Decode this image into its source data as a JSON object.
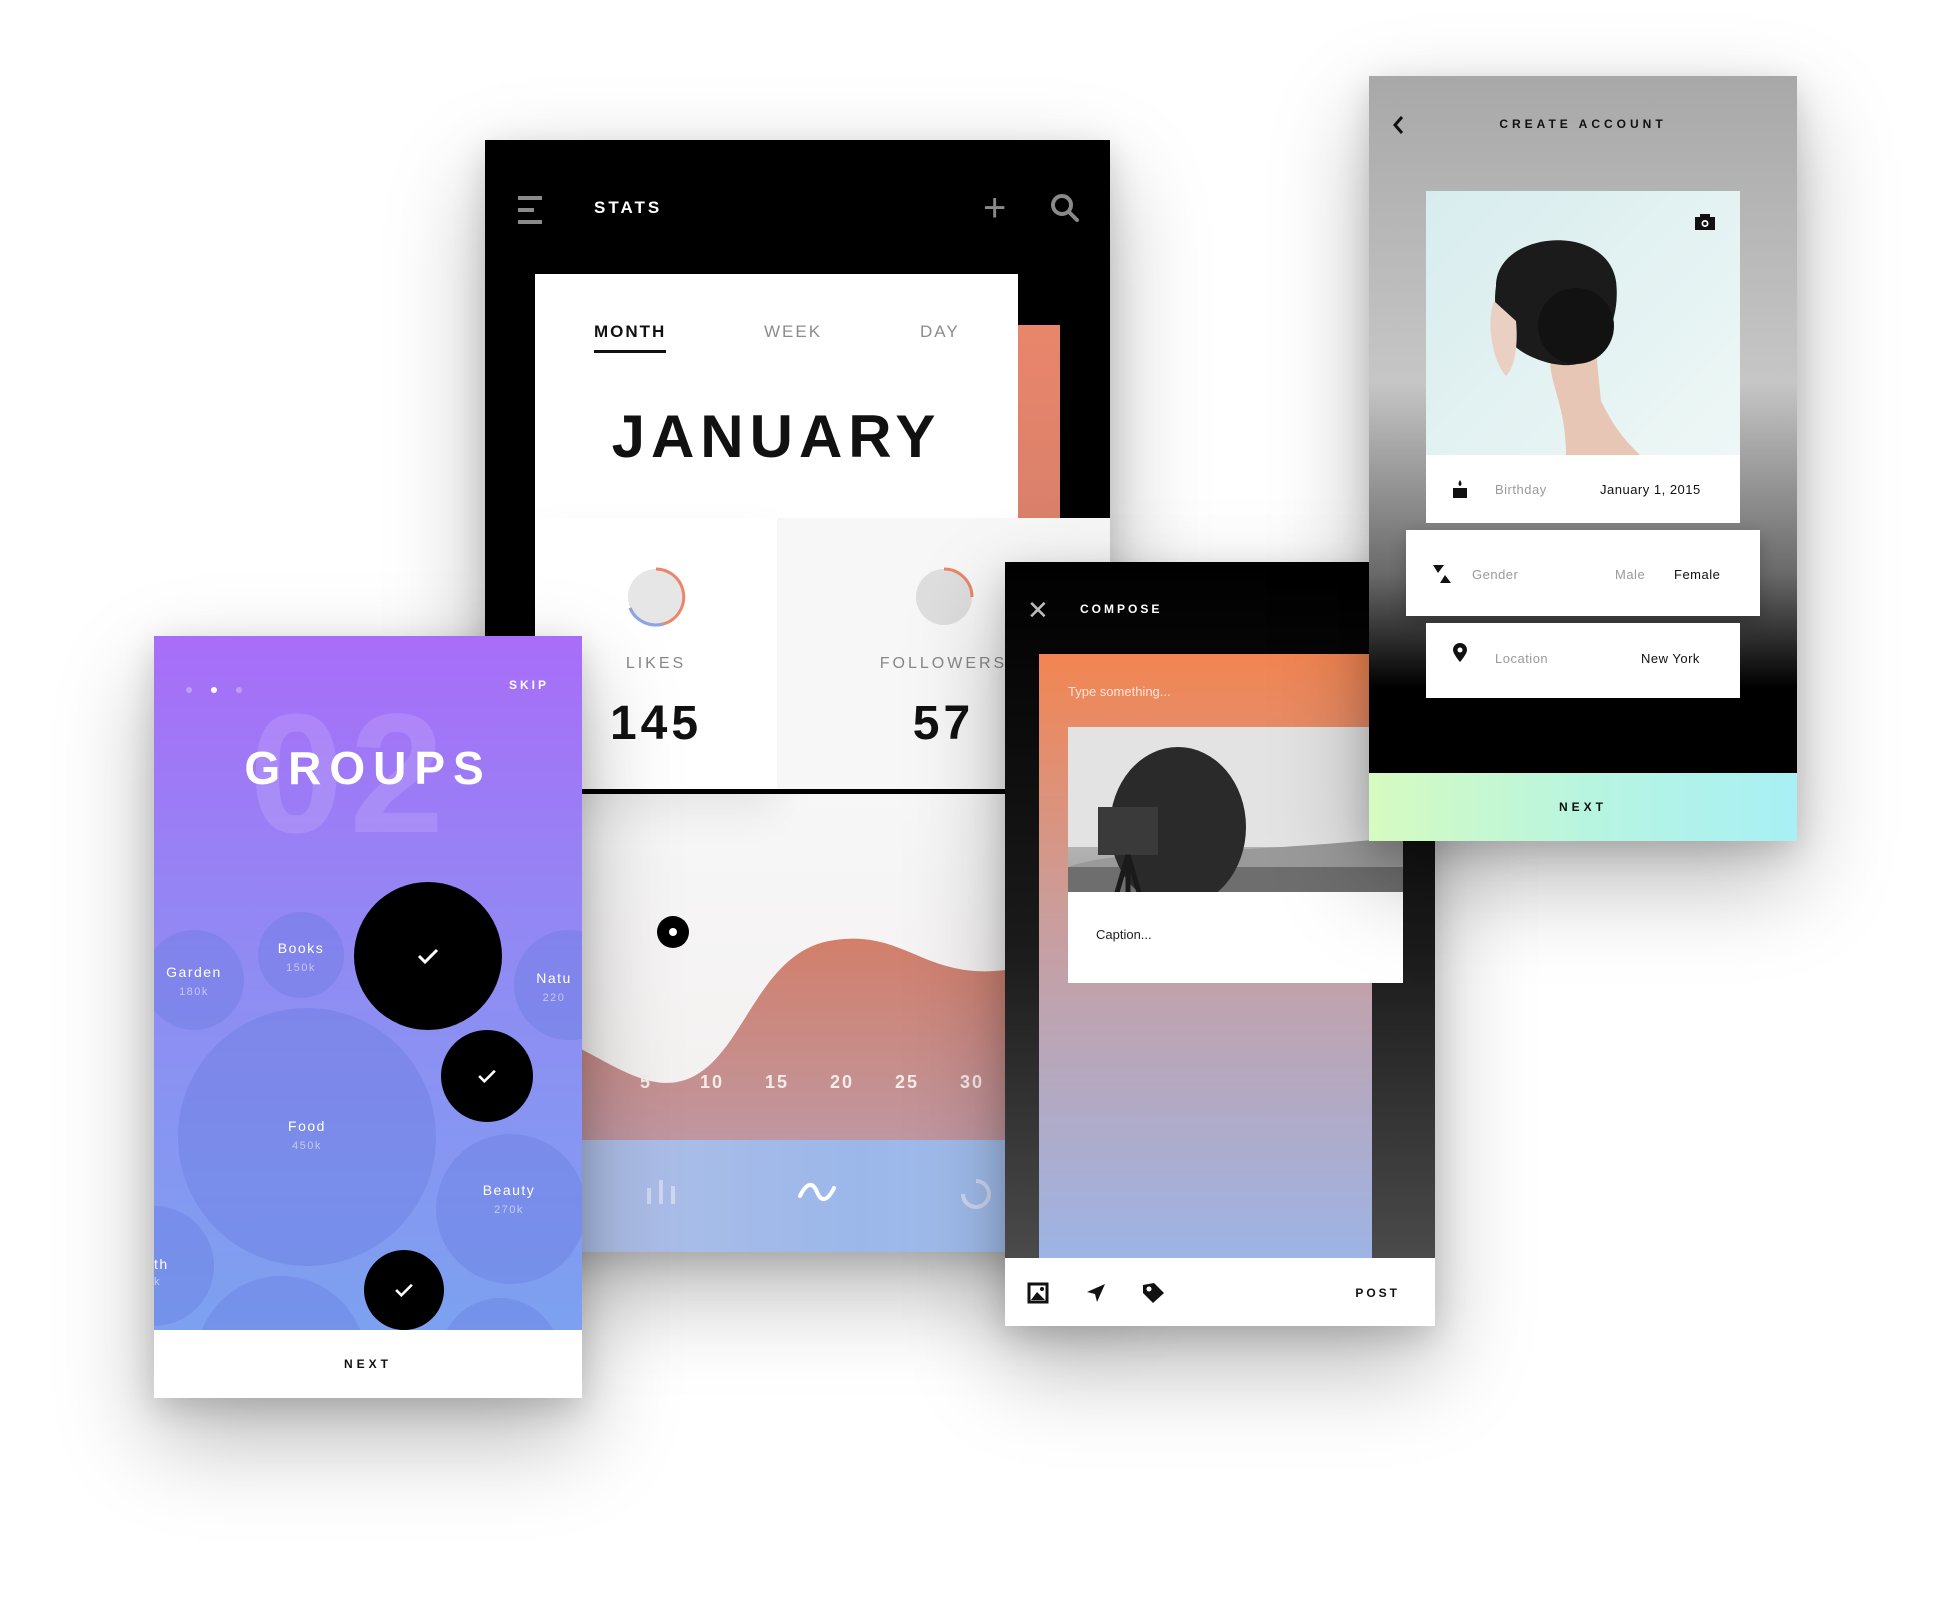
{
  "stats": {
    "title": "STATS",
    "tabs": [
      "MONTH",
      "WEEK",
      "DAY"
    ],
    "active_tab": "MONTH",
    "month": "JANUARY",
    "likes_label": "LIKES",
    "likes_value": "145",
    "followers_label": "FOLLOWERS",
    "followers_value": "57",
    "days": [
      "5",
      "10",
      "15",
      "20",
      "25",
      "30"
    ],
    "accent": "#e9866b"
  },
  "groups": {
    "skip": "SKIP",
    "page_number": "02",
    "heading": "GROUPS",
    "bubbles": [
      {
        "name": "Garden",
        "count": "180k"
      },
      {
        "name": "Books",
        "count": "150k"
      },
      {
        "name": "Natu",
        "count": "220"
      },
      {
        "name": "Food",
        "count": "450k"
      },
      {
        "name": "Beauty",
        "count": "270k"
      },
      {
        "name": "th",
        "count": "k"
      }
    ],
    "next": "NEXT",
    "gradient_start": "#a86df8",
    "gradient_end": "#79a5ef"
  },
  "compose": {
    "title": "COMPOSE",
    "placeholder": "Type something...",
    "caption_placeholder": "Caption...",
    "post": "POST"
  },
  "account": {
    "title": "CREATE ACCOUNT",
    "birthday_label": "Birthday",
    "birthday_value": "January 1, 2015",
    "gender_label": "Gender",
    "gender_option_1": "Male",
    "gender_option_2": "Female",
    "gender_selected": "Female",
    "location_label": "Location",
    "location_value": "New York",
    "next": "NEXT"
  }
}
